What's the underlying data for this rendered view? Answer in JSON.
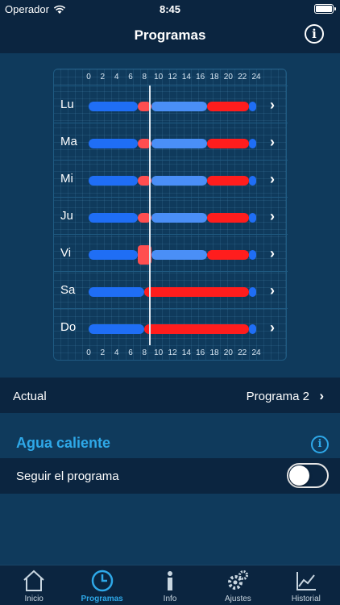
{
  "status": {
    "carrier": "Operador",
    "time": "8:45"
  },
  "nav": {
    "title": "Programas"
  },
  "schedule": {
    "hour_ticks": [
      "0",
      "2",
      "4",
      "6",
      "8",
      "10",
      "12",
      "14",
      "16",
      "18",
      "20",
      "22",
      "24"
    ],
    "now_hour": 8.7,
    "days": [
      {
        "label": "Lu",
        "segments": [
          {
            "from": 0,
            "to": 7,
            "color": "#1f6ef5"
          },
          {
            "from": 7,
            "to": 9,
            "color": "#ff4e50"
          },
          {
            "from": 9,
            "to": 17,
            "color": "#4a8ff7"
          },
          {
            "from": 17,
            "to": 23,
            "color": "#ff1d1d"
          },
          {
            "from": 23,
            "to": 24,
            "color": "#1f6ef5"
          }
        ]
      },
      {
        "label": "Ma",
        "segments": [
          {
            "from": 0,
            "to": 7,
            "color": "#1f6ef5"
          },
          {
            "from": 7,
            "to": 9,
            "color": "#ff4e50"
          },
          {
            "from": 9,
            "to": 17,
            "color": "#4a8ff7"
          },
          {
            "from": 17,
            "to": 23,
            "color": "#ff1d1d"
          },
          {
            "from": 23,
            "to": 24,
            "color": "#1f6ef5"
          }
        ]
      },
      {
        "label": "Mi",
        "segments": [
          {
            "from": 0,
            "to": 7,
            "color": "#1f6ef5"
          },
          {
            "from": 7,
            "to": 9,
            "color": "#ff4e50"
          },
          {
            "from": 9,
            "to": 17,
            "color": "#4a8ff7"
          },
          {
            "from": 17,
            "to": 23,
            "color": "#ff1d1d"
          },
          {
            "from": 23,
            "to": 24,
            "color": "#1f6ef5"
          }
        ]
      },
      {
        "label": "Ju",
        "segments": [
          {
            "from": 0,
            "to": 7,
            "color": "#1f6ef5"
          },
          {
            "from": 7,
            "to": 9,
            "color": "#ff4e50"
          },
          {
            "from": 9,
            "to": 17,
            "color": "#4a8ff7"
          },
          {
            "from": 17,
            "to": 23,
            "color": "#ff1d1d"
          },
          {
            "from": 23,
            "to": 24,
            "color": "#1f6ef5"
          }
        ]
      },
      {
        "label": "Vi",
        "segments": [
          {
            "from": 0,
            "to": 7,
            "color": "#1f6ef5"
          },
          {
            "from": 7,
            "to": 9,
            "color": "#ff4e50",
            "highlight": true
          },
          {
            "from": 9,
            "to": 17,
            "color": "#4a8ff7"
          },
          {
            "from": 17,
            "to": 23,
            "color": "#ff1d1d"
          },
          {
            "from": 23,
            "to": 24,
            "color": "#1f6ef5"
          }
        ]
      },
      {
        "label": "Sa",
        "segments": [
          {
            "from": 0,
            "to": 8,
            "color": "#1f6ef5"
          },
          {
            "from": 8,
            "to": 23,
            "color": "#ff1d1d"
          },
          {
            "from": 23,
            "to": 24,
            "color": "#1f6ef5"
          }
        ]
      },
      {
        "label": "Do",
        "segments": [
          {
            "from": 0,
            "to": 8,
            "color": "#1f6ef5"
          },
          {
            "from": 8,
            "to": 23,
            "color": "#ff1d1d"
          },
          {
            "from": 23,
            "to": 24,
            "color": "#1f6ef5"
          }
        ]
      }
    ]
  },
  "actual": {
    "label": "Actual",
    "value": "Programa 2"
  },
  "hot_water": {
    "title": "Agua caliente",
    "follow_label": "Seguir el programa",
    "follow_on": false
  },
  "tabs": [
    {
      "label": "Inicio",
      "icon": "house-icon",
      "active": false
    },
    {
      "label": "Programas",
      "icon": "clock-icon",
      "active": true
    },
    {
      "label": "Info",
      "icon": "info-icon",
      "active": false
    },
    {
      "label": "Ajustes",
      "icon": "gears-icon",
      "active": false
    },
    {
      "label": "Historial",
      "icon": "chart-icon",
      "active": false
    }
  ],
  "colors": {
    "accent": "#2ea8e8",
    "comfort": "#ff1d1d",
    "eco": "#1f6ef5",
    "background": "#0f3a5c",
    "panel": "#0b2540"
  }
}
